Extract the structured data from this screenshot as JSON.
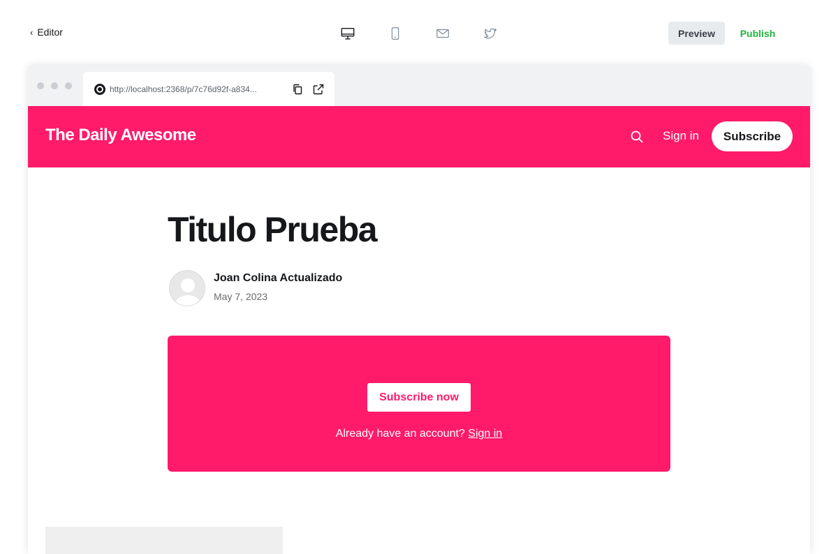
{
  "editor": {
    "back_label": "Editor",
    "devices": [
      "desktop-icon",
      "mobile-icon",
      "email-icon",
      "twitter-icon"
    ],
    "preview_label": "Preview",
    "publish_label": "Publish"
  },
  "browser": {
    "url": "http://localhost:2368/p/7c76d92f-a834..."
  },
  "site": {
    "title": "The Daily Awesome",
    "signin_label": "Sign in",
    "subscribe_label": "Subscribe",
    "accent_color": "#ff1a6a"
  },
  "post": {
    "title": "Titulo Prueba",
    "author": "Joan Colina Actualizado",
    "date": "May 7, 2023"
  },
  "cta": {
    "button_label": "Subscribe now",
    "account_text": "Already have an account?",
    "signin_label": "Sign in"
  }
}
